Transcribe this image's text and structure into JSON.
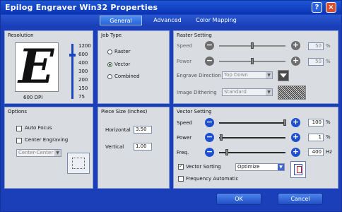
{
  "window": {
    "title": "Epilog Engraver Win32 Properties",
    "help_label": "?",
    "close_label": "×"
  },
  "tabs": [
    {
      "label": "General"
    },
    {
      "label": "Advanced"
    },
    {
      "label": "Color Mapping"
    }
  ],
  "resolution": {
    "title": "Resolution",
    "preview_letter": "E",
    "current_label": "600 DPI",
    "scale": [
      "1200",
      "600",
      "400",
      "300",
      "200",
      "150",
      "75"
    ]
  },
  "job_type": {
    "title": "Job Type",
    "options": [
      {
        "label": "Raster",
        "selected": false
      },
      {
        "label": "Vector",
        "selected": true
      },
      {
        "label": "Combined",
        "selected": false
      }
    ]
  },
  "raster_setting": {
    "title": "Raster Setting",
    "speed": {
      "label": "Speed",
      "value": "50",
      "unit": "%"
    },
    "power": {
      "label": "Power",
      "value": "50",
      "unit": "%"
    },
    "engrave_direction": {
      "label": "Engrave Direction",
      "value": "Top Down"
    },
    "image_dithering": {
      "label": "Image Dithering",
      "value": "Standard"
    }
  },
  "options": {
    "title": "Options",
    "auto_focus": {
      "label": "Auto Focus",
      "checked": false
    },
    "center_engraving": {
      "label": "Center Engraving",
      "checked": false
    },
    "center_select": {
      "value": "Center-Center"
    }
  },
  "piece_size": {
    "title": "Piece Size (inches)",
    "horizontal": {
      "label": "Horizontal",
      "value": "3.50"
    },
    "vertical": {
      "label": "Vertical",
      "value": "1.00"
    }
  },
  "vector_setting": {
    "title": "Vector Setting",
    "speed": {
      "label": "Speed",
      "value": "100",
      "unit": "%"
    },
    "power": {
      "label": "Power",
      "value": "1",
      "unit": "%"
    },
    "freq": {
      "label": "Freq.",
      "value": "400",
      "unit": "Hz"
    },
    "vector_sorting": {
      "label": "Vector Sorting",
      "checked": true,
      "value": "Optimize"
    },
    "frequency_automatic": {
      "label": "Frequency Automatic",
      "checked": false
    }
  },
  "footer": {
    "ok_label": "OK",
    "cancel_label": "Cancel"
  },
  "colors": {
    "titlebar": "#1b4fcf",
    "window_bg": "#1b3fb8",
    "panel_bg": "#d9dde2",
    "accent": "#1d4fcf"
  }
}
